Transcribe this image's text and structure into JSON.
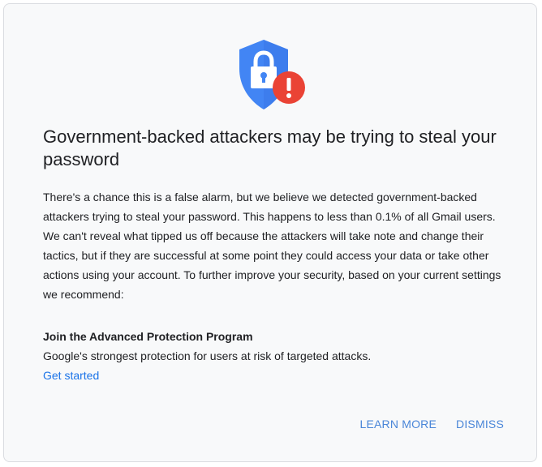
{
  "dialog": {
    "title": "Government-backed attackers may be trying to steal your password",
    "body": "There's a chance this is a false alarm, but we believe we detected government-backed attackers trying to steal your password. This happens to less than 0.1% of all Gmail users. We can't reveal what tipped us off because the attackers will take note and change their tactics, but if they are successful at some point they could access your data or take other actions using your account. To further improve your security, based on your current settings we recommend:",
    "recommendation": {
      "title": "Join the Advanced Protection Program",
      "description": "Google's strongest protection for users at risk of targeted attacks.",
      "link_label": "Get started"
    },
    "actions": {
      "learn_more_label": "LEARN MORE",
      "dismiss_label": "DISMISS"
    },
    "icon": {
      "shield": "shield-lock-icon",
      "alert": "alert-icon"
    }
  },
  "colors": {
    "shield_blue": "#4285f4",
    "shield_dark_blue": "#2f6fd8",
    "alert_red": "#ea4335",
    "link_blue": "#1a73e8",
    "button_blue": "#4a86d8",
    "text": "#202124"
  }
}
